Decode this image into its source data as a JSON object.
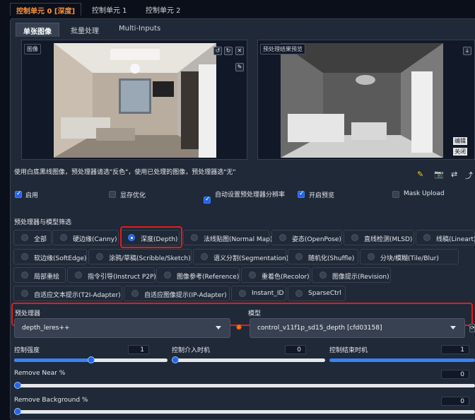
{
  "top_tabs": [
    "控制单元 0 [深度]",
    "控制单元 1",
    "控制单元 2"
  ],
  "sub_tabs": [
    "单张图像",
    "批量处理",
    "Multi-Inputs"
  ],
  "image_label": "图像",
  "preview_label": "预处理结果预览",
  "side_buttons": {
    "edit": "编辑",
    "close": "关闭"
  },
  "hint": "使用白底黑线图像，预处理器请选\"反色\"，使用已处理的图像，预处理器选\"无\"",
  "checkboxes": [
    {
      "label": "启用",
      "checked": true
    },
    {
      "label": "显存优化",
      "checked": false
    },
    {
      "label": "自动设置预处理器分辨率",
      "checked": true
    },
    {
      "label": "开启预览",
      "checked": true
    },
    {
      "label": "Mask Upload",
      "checked": false
    }
  ],
  "filter_title": "预处理器与模型筛选",
  "radios": [
    {
      "label": "全部",
      "selected": false
    },
    {
      "label": "硬边缘(Canny)",
      "selected": false
    },
    {
      "label": "深度(Depth)",
      "selected": true
    },
    {
      "label": "法线贴图(Normal Map)",
      "selected": false
    },
    {
      "label": "姿态(OpenPose)",
      "selected": false
    },
    {
      "label": "直线检测(MLSD)",
      "selected": false
    },
    {
      "label": "线稿(Lineart)",
      "selected": false
    },
    {
      "label": "软边缘(SoftEdge)",
      "selected": false
    },
    {
      "label": "涂鸦/草稿(Scribble/Sketch)",
      "selected": false
    },
    {
      "label": "语义分割(Segmentation)",
      "selected": false
    },
    {
      "label": "随机化(Shuffle)",
      "selected": false
    },
    {
      "label": "分块/模糊(Tile/Blur)",
      "selected": false
    },
    {
      "label": "局部重绘",
      "selected": false
    },
    {
      "label": "指令引导(Instruct P2P)",
      "selected": false
    },
    {
      "label": "图像参考(Reference)",
      "selected": false
    },
    {
      "label": "重着色(Recolor)",
      "selected": false
    },
    {
      "label": "图像提示(Revision)",
      "selected": false
    },
    {
      "label": "自适应文本提示(T2I-Adapter)",
      "selected": false
    },
    {
      "label": "自适应图像提示(IP-Adapter)",
      "selected": false
    },
    {
      "label": "Instant_ID",
      "selected": false
    },
    {
      "label": "SparseCtrl",
      "selected": false
    }
  ],
  "preprocessor": {
    "label": "预处理器",
    "value": "depth_leres++"
  },
  "model": {
    "label": "模型",
    "value": "control_v11f1p_sd15_depth [cfd03158]"
  },
  "sliders": {
    "weight": {
      "label": "控制强度",
      "value": "1",
      "fraction": 0.5
    },
    "start": {
      "label": "控制介入时机",
      "value": "0",
      "fraction": 0
    },
    "end": {
      "label": "控制结束时机",
      "value": "1",
      "fraction": 1
    },
    "near": {
      "label": "Remove Near %",
      "value": "0",
      "fraction": 0
    },
    "background": {
      "label": "Remove Background %",
      "value": "0",
      "fraction": 0
    }
  },
  "icons": {
    "swap": "swap-icon",
    "camera": "camera-icon",
    "edit": "edit-icon",
    "send": "send-icon"
  },
  "colors": {
    "accent": "#fb923c",
    "highlight": "#e11d1d",
    "primary": "#2563eb",
    "background": "#0b0f19",
    "panel": "#1f2937"
  }
}
